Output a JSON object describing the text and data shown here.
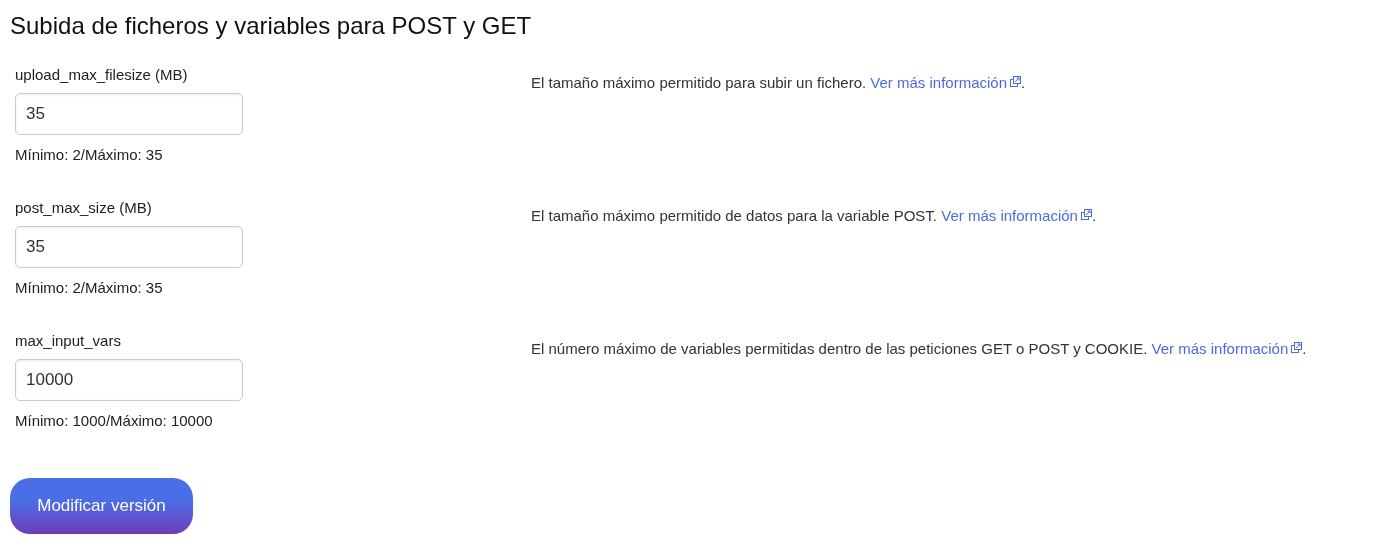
{
  "title": "Subida de ficheros y variables para POST y GET",
  "settings": [
    {
      "label": "upload_max_filesize (MB)",
      "value": "35",
      "range": "Mínimo: 2/Máximo: 35",
      "description": "El tamaño máximo permitido para subir un fichero.",
      "link": "Ver más información",
      "end": "."
    },
    {
      "label": "post_max_size (MB)",
      "value": "35",
      "range": "Mínimo: 2/Máximo: 35",
      "description": "El tamaño máximo permitido de datos para la variable POST.",
      "link": "Ver más información",
      "end": "."
    },
    {
      "label": "max_input_vars",
      "value": "10000",
      "range": "Mínimo: 1000/Máximo: 10000",
      "description": "El número máximo de variables permitidas dentro de las peticiones GET o POST y COOKIE.",
      "link": "Ver más información",
      "end": "."
    }
  ],
  "button": "Modificar versión"
}
